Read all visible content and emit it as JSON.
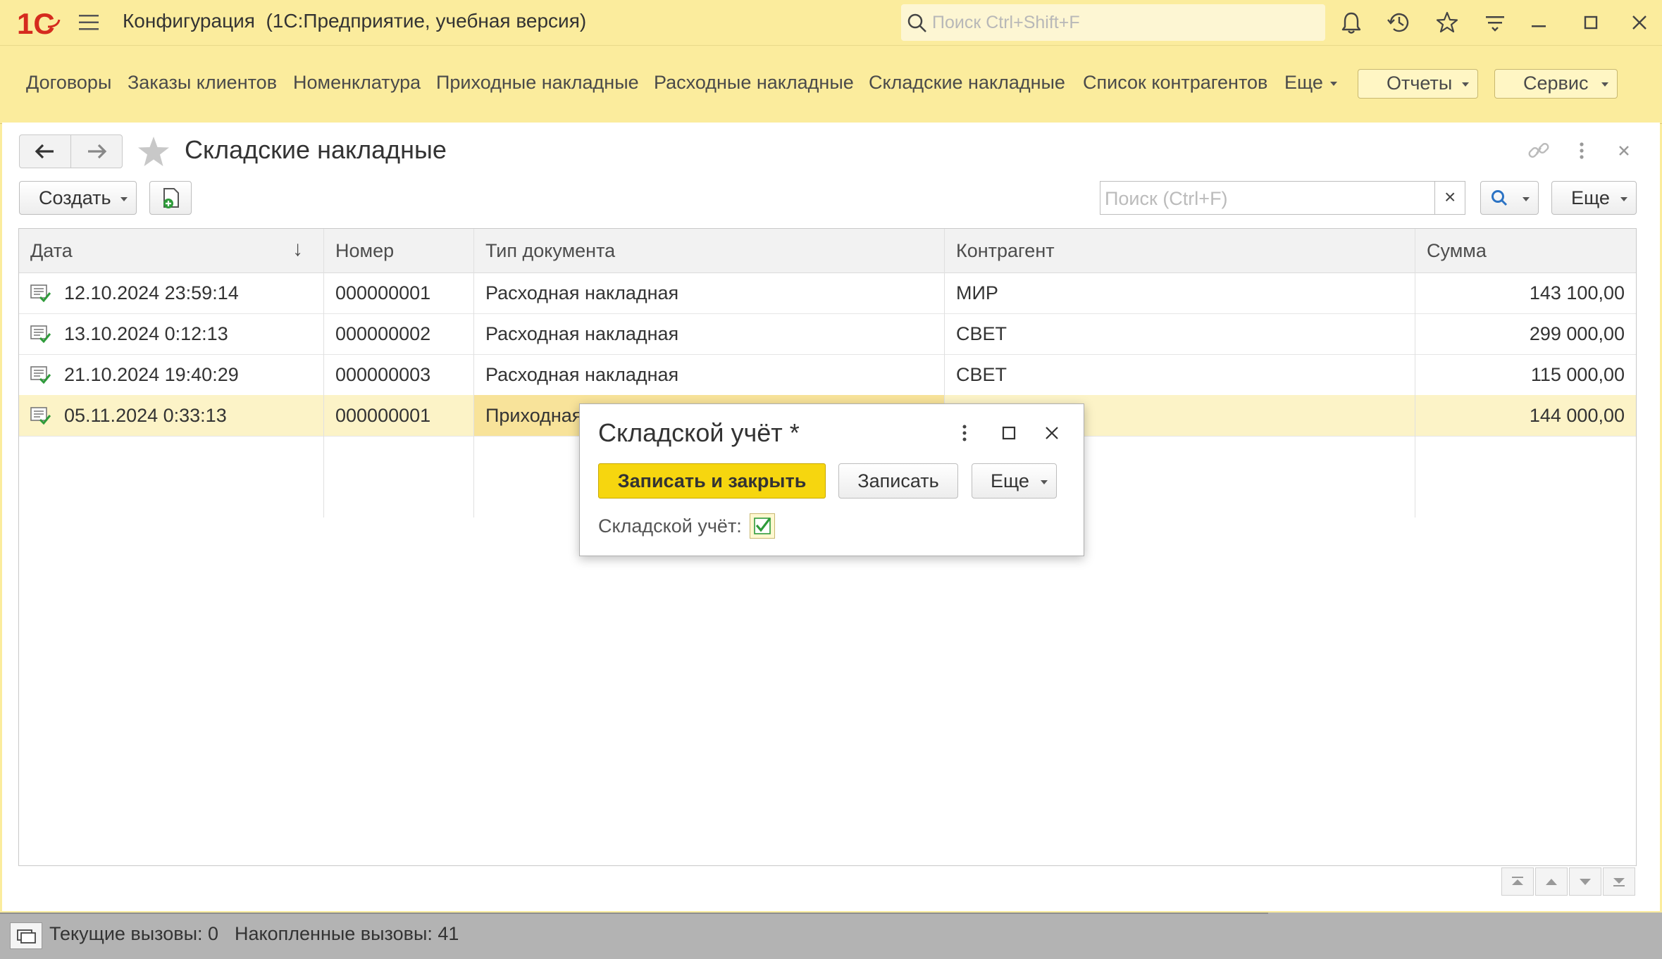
{
  "titlebar": {
    "logo_text": "1С",
    "app_title": "Конфигурация  (1С:Предприятие, учебная версия)",
    "search_placeholder": "Поиск Ctrl+Shift+F"
  },
  "sections": {
    "links": [
      "Договоры",
      "Заказы клиентов",
      "Номенклатура",
      "Приходные накладные",
      "Расходные накладные",
      "Складские накладные",
      "Список контрагентов",
      "Еще"
    ],
    "reports_label": "Отчеты",
    "service_label": "Сервис"
  },
  "form": {
    "title": "Складские накладные",
    "create_label": "Создать",
    "search_placeholder": "Поиск (Ctrl+F)",
    "more_label": "Еще",
    "clear_glyph": "×"
  },
  "table": {
    "columns": [
      "Дата",
      "Номер",
      "Тип документа",
      "Контрагент",
      "Сумма"
    ],
    "sort_indicator": "↓",
    "rows": [
      {
        "date": "12.10.2024 23:59:14",
        "number": "000000001",
        "type": "Расходная накладная",
        "counterparty": "МИР",
        "sum": "143 100,00"
      },
      {
        "date": "13.10.2024 0:12:13",
        "number": "000000002",
        "type": "Расходная накладная",
        "counterparty": "СВЕТ",
        "sum": "299 000,00"
      },
      {
        "date": "21.10.2024 19:40:29",
        "number": "000000003",
        "type": "Расходная накладная",
        "counterparty": "СВЕТ",
        "sum": "115 000,00"
      },
      {
        "date": "05.11.2024 0:33:13",
        "number": "000000001",
        "type": "Приходная",
        "counterparty": "",
        "sum": "144 000,00"
      }
    ],
    "selected_row": 3
  },
  "popup": {
    "title": "Складской учёт *",
    "save_close_label": "Записать и закрыть",
    "save_label": "Записать",
    "more_label": "Еще",
    "checkbox_label": "Складской учёт:",
    "checkbox_checked": true
  },
  "statusbar": {
    "current_calls": "Текущие вызовы: 0",
    "accumulated_calls": "Накопленные вызовы: 41"
  },
  "colors": {
    "brand_yellow": "#FBEC9D",
    "primary_button": "#F6D60F",
    "logo_red": "#D52B1E",
    "selected_row": "#FCF3C7",
    "check_green": "#2E9B3A"
  }
}
